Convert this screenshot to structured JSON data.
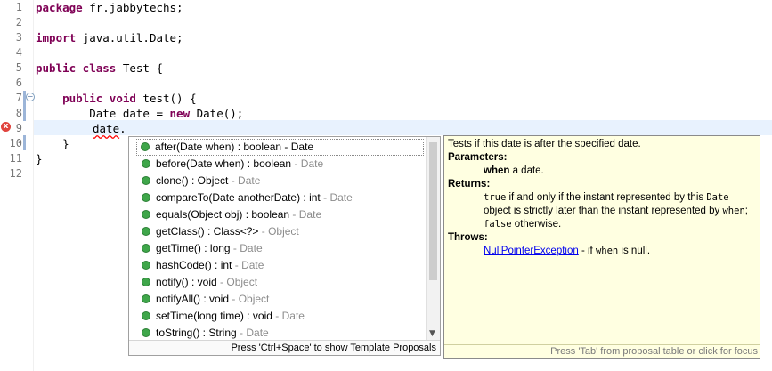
{
  "editor": {
    "line_numbers": [
      "1",
      "2",
      "3",
      "4",
      "5",
      "6",
      "7",
      "8",
      "9",
      "10",
      "11",
      "12"
    ],
    "lines": [
      {
        "kw": "package",
        "rest": " fr.jabbytechs;"
      },
      {
        "kw": "",
        "rest": ""
      },
      {
        "kw": "import",
        "rest": " java.util.Date;"
      },
      {
        "kw": "",
        "rest": ""
      },
      {
        "kw": "public class",
        "rest": " Test {"
      },
      {
        "kw": "",
        "rest": ""
      },
      {
        "kw": "public void",
        "rest": " test() {",
        "indent": "    "
      },
      {
        "pre": "        Date date = ",
        "kw": "new",
        "rest": " Date();"
      },
      {
        "err": "date",
        "rest": "."
      },
      {
        "rest": "    }"
      },
      {
        "rest": "}"
      },
      {
        "rest": ""
      }
    ],
    "error_marker": "x"
  },
  "completion": {
    "items": [
      {
        "sig": "after(Date when) : boolean",
        "owner": "Date",
        "selected": true
      },
      {
        "sig": "before(Date when) : boolean",
        "owner": "Date"
      },
      {
        "sig": "clone() : Object",
        "owner": "Date"
      },
      {
        "sig": "compareTo(Date anotherDate) : int",
        "owner": "Date"
      },
      {
        "sig": "equals(Object obj) : boolean",
        "owner": "Date"
      },
      {
        "sig": "getClass() : Class<?>",
        "owner": "Object"
      },
      {
        "sig": "getTime() : long",
        "owner": "Date"
      },
      {
        "sig": "hashCode() : int",
        "owner": "Date"
      },
      {
        "sig": "notify() : void",
        "owner": "Object"
      },
      {
        "sig": "notifyAll() : void",
        "owner": "Object"
      },
      {
        "sig": "setTime(long time) : void",
        "owner": "Date"
      },
      {
        "sig": "toString() : String",
        "owner": "Date"
      }
    ],
    "separator": " - ",
    "footer": "Press 'Ctrl+Space' to show Template Proposals",
    "scroll_down_arrow": "▼"
  },
  "javadoc": {
    "summary": "Tests if this date is after the specified date.",
    "parameters_label": "Parameters:",
    "param_name": "when",
    "param_desc": " a date.",
    "returns_label": "Returns:",
    "returns_true": "true",
    "returns_mid": " if and only if the instant represented by this ",
    "returns_date": "Date",
    "returns_line2": "object is strictly later than the instant represented by ",
    "returns_when": "when",
    "returns_semi": ";",
    "returns_false": "false",
    "returns_end": " otherwise.",
    "throws_label": "Throws:",
    "throws_link": "NullPointerException",
    "throws_desc_a": " - if ",
    "throws_when": "when",
    "throws_desc_b": " is null.",
    "footer": "Press 'Tab' from proposal table or click for focus"
  }
}
